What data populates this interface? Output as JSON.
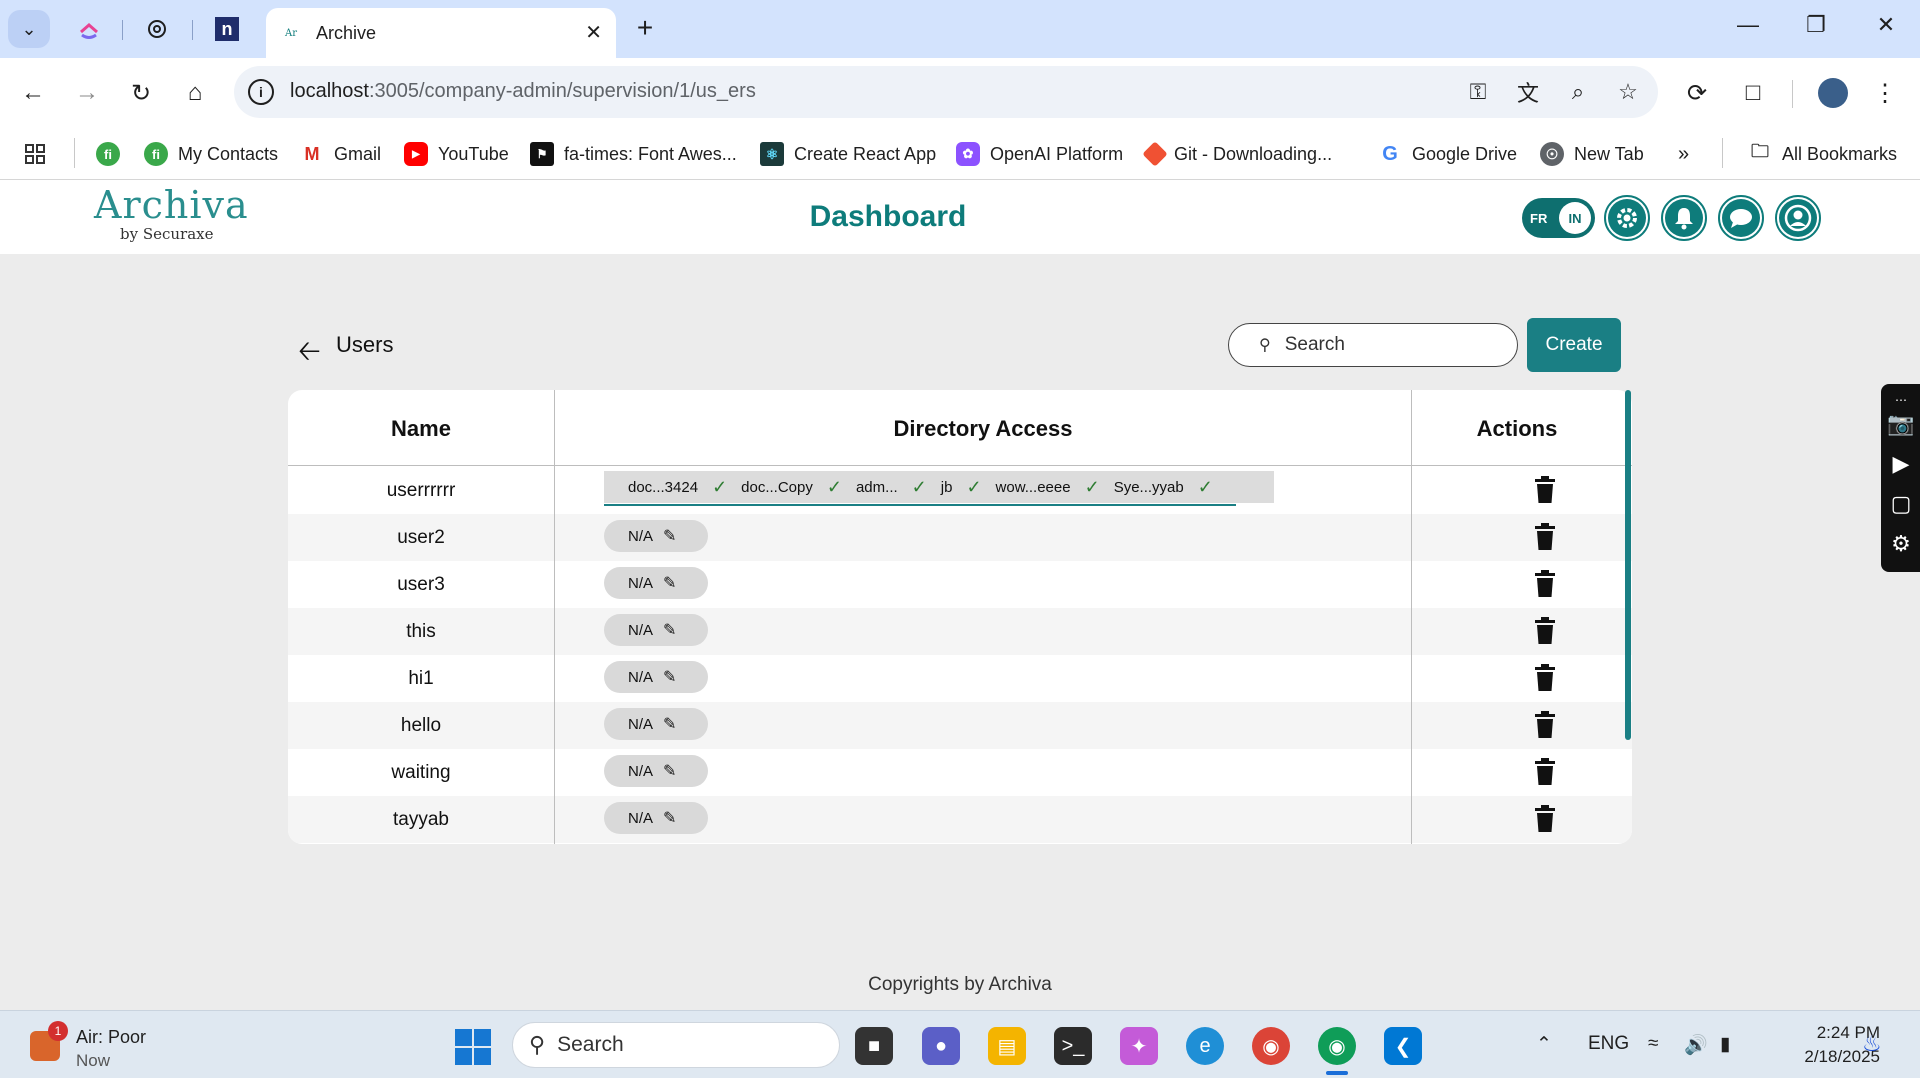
{
  "browser": {
    "active_tab_title": "Archive",
    "url_host": "localhost",
    "url_rest": ":3005/company-admin/supervision/1/us_ers",
    "bookmarks": [
      {
        "label": "",
        "icon": "apps-grid-icon"
      },
      {
        "label": "",
        "icon": "fi-icon"
      },
      {
        "label": "My Contacts",
        "icon": "fi-icon"
      },
      {
        "label": "Gmail",
        "icon": "gmail-icon"
      },
      {
        "label": "YouTube",
        "icon": "youtube-icon"
      },
      {
        "label": "fa-times: Font Awes...",
        "icon": "flag-icon"
      },
      {
        "label": "Create React App",
        "icon": "react-icon"
      },
      {
        "label": "OpenAI Platform",
        "icon": "openai-icon"
      },
      {
        "label": "Git - Downloading...",
        "icon": "git-icon"
      },
      {
        "label": "Google Drive",
        "icon": "google-icon"
      },
      {
        "label": "New Tab",
        "icon": "globe-icon"
      },
      {
        "label": "All Bookmarks",
        "icon": "folder-icon"
      }
    ]
  },
  "app": {
    "logo_text": "Archiva",
    "logo_sub": "by Securaxe",
    "page_title": "Dashboard",
    "lang_left": "FR",
    "lang_right": "IN",
    "accent": "#0e7c7b"
  },
  "users_page": {
    "heading": "Users",
    "search_placeholder": "Search",
    "create_label": "Create",
    "columns": [
      "Name",
      "Directory Access",
      "Actions"
    ],
    "first_row_directories": [
      "doc...3424",
      "doc...Copy",
      "adm...",
      "jb",
      "wow...eeee",
      "Sye...yyab"
    ],
    "na_label": "N/A",
    "rows": [
      {
        "name": "userrrrrr"
      },
      {
        "name": "user2"
      },
      {
        "name": "user3"
      },
      {
        "name": "this"
      },
      {
        "name": "hi1"
      },
      {
        "name": "hello"
      },
      {
        "name": "waiting"
      },
      {
        "name": "tayyab"
      }
    ]
  },
  "footer": "Copyrights by Archiva",
  "taskbar": {
    "weather_title": "Air: Poor",
    "weather_sub": "Now",
    "weather_badge": "1",
    "search_placeholder": "Search",
    "lang": "ENG",
    "time": "2:24 PM",
    "date": "2/18/2025"
  }
}
